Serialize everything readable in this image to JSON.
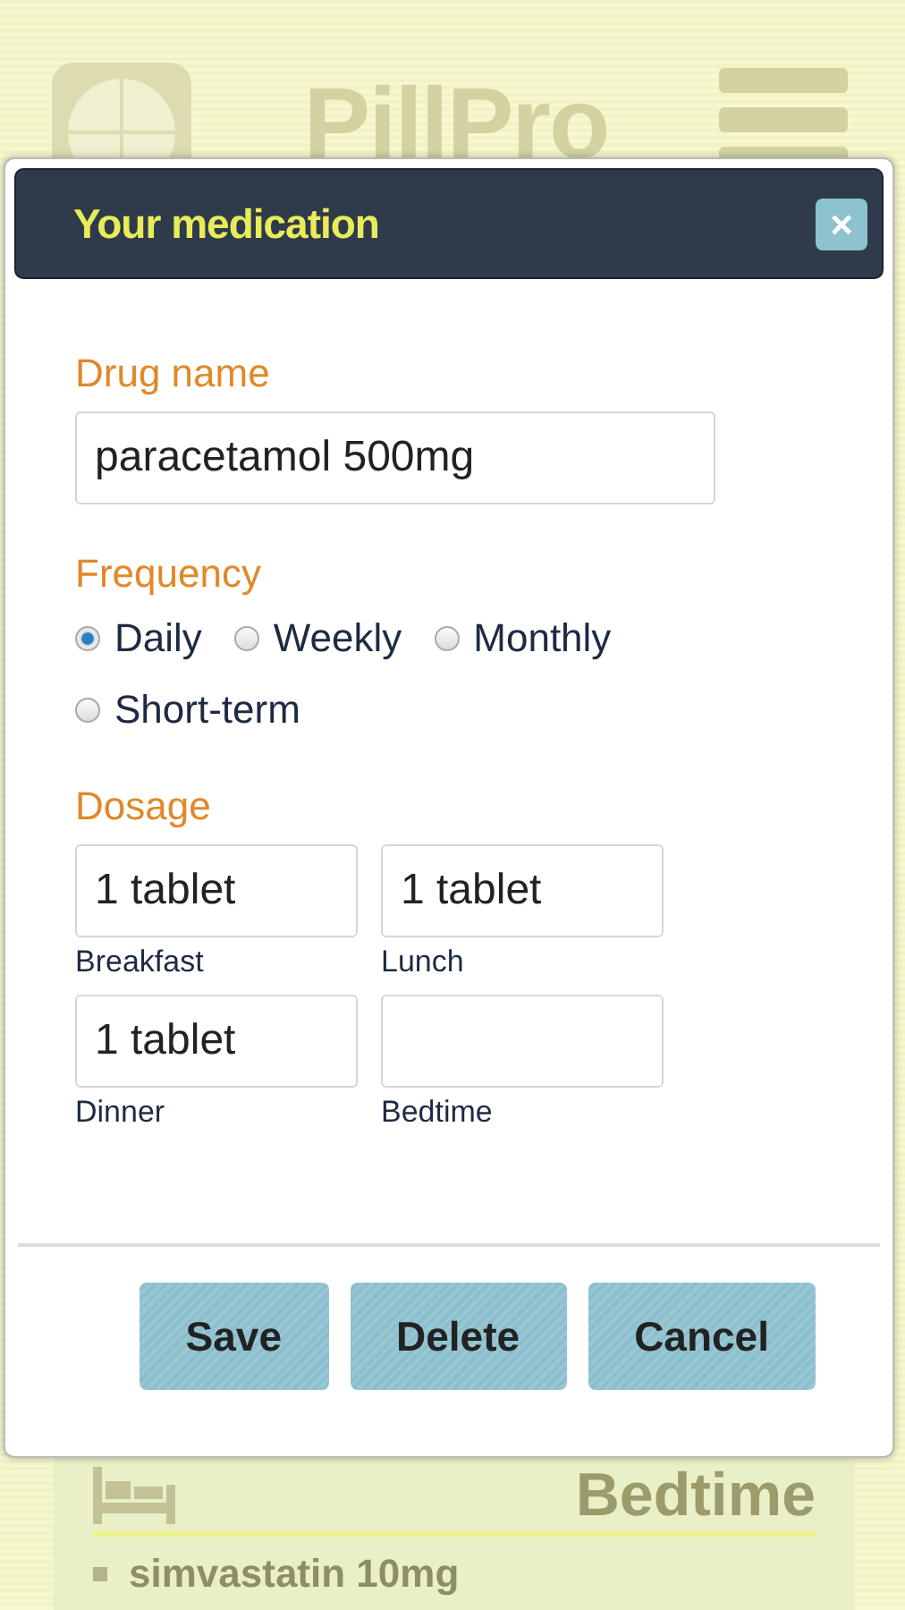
{
  "app": {
    "title": "PillPro"
  },
  "schedule_card": {
    "title": "Bedtime",
    "medications": [
      "simvastatin 10mg"
    ]
  },
  "dialog": {
    "title": "Your medication",
    "close_label": "×",
    "drug_name": {
      "label": "Drug name",
      "value": "paracetamol 500mg"
    },
    "frequency": {
      "label": "Frequency",
      "options": [
        {
          "label": "Daily",
          "selected": true
        },
        {
          "label": "Weekly",
          "selected": false
        },
        {
          "label": "Monthly",
          "selected": false
        },
        {
          "label": "Short-term",
          "selected": false
        }
      ]
    },
    "dosage": {
      "label": "Dosage",
      "fields": [
        {
          "label": "Breakfast",
          "value": "1 tablet"
        },
        {
          "label": "Lunch",
          "value": "1 tablet"
        },
        {
          "label": "Dinner",
          "value": "1 tablet"
        },
        {
          "label": "Bedtime"
        }
      ]
    },
    "buttons": [
      "Save",
      "Delete",
      "Cancel"
    ]
  }
}
